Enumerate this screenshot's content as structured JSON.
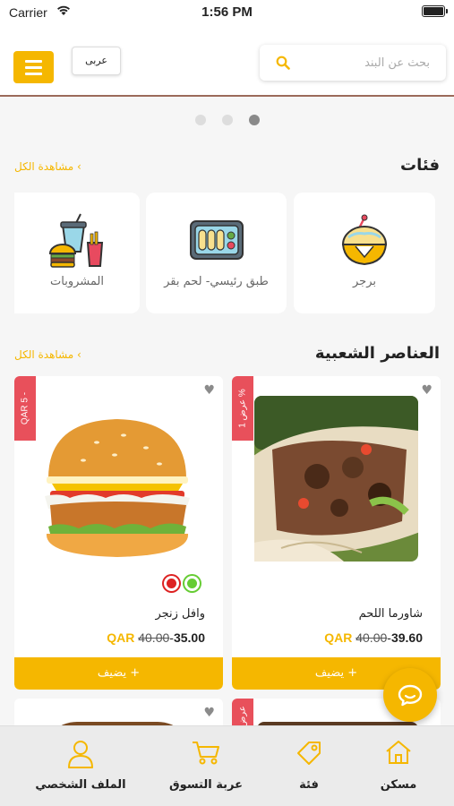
{
  "status_bar": {
    "carrier": "Carrier",
    "time": "1:56 PM"
  },
  "header": {
    "language": "عربى",
    "search_placeholder": "بحث عن البند"
  },
  "carousel": {
    "pages": 3,
    "active": 3
  },
  "categories": {
    "title": "فئات",
    "see_all": "مشاهدة الكل ‹",
    "items": [
      {
        "label": "برجر",
        "icon": "burger-icon"
      },
      {
        "label": "طبق رئيسي- لحم بقر",
        "icon": "main-dish-icon"
      },
      {
        "label": "المشروبات",
        "icon": "drinks-icon"
      }
    ]
  },
  "popular": {
    "title": "العناصر الشعبية",
    "see_all": "مشاهدة الكل ‹",
    "products": [
      {
        "name": "شاورما اللحم",
        "ribbon": "عرض 1 %",
        "old_price": "40.00",
        "price": "39.60",
        "currency": "QAR",
        "add_label": "يضيف +"
      },
      {
        "name": "وافل زنجر",
        "ribbon": "QAR 5 -",
        "old_price": "40.00",
        "price": "35.00",
        "currency": "QAR",
        "add_label": "يضيف +",
        "colors": [
          "#66cc33",
          "#dd2222"
        ]
      }
    ],
    "next_row_ribbon": "عرض"
  },
  "tabbar": {
    "items": [
      {
        "label": "مسكن",
        "icon": "home-icon"
      },
      {
        "label": "فئة",
        "icon": "tag-icon"
      },
      {
        "label": "عربة التسوق",
        "icon": "cart-icon"
      },
      {
        "label": "الملف الشخصي",
        "icon": "profile-icon"
      }
    ]
  },
  "colors": {
    "accent": "#f5b700",
    "ribbon": "#e8505b",
    "active_dot": "#8a8a8a"
  }
}
